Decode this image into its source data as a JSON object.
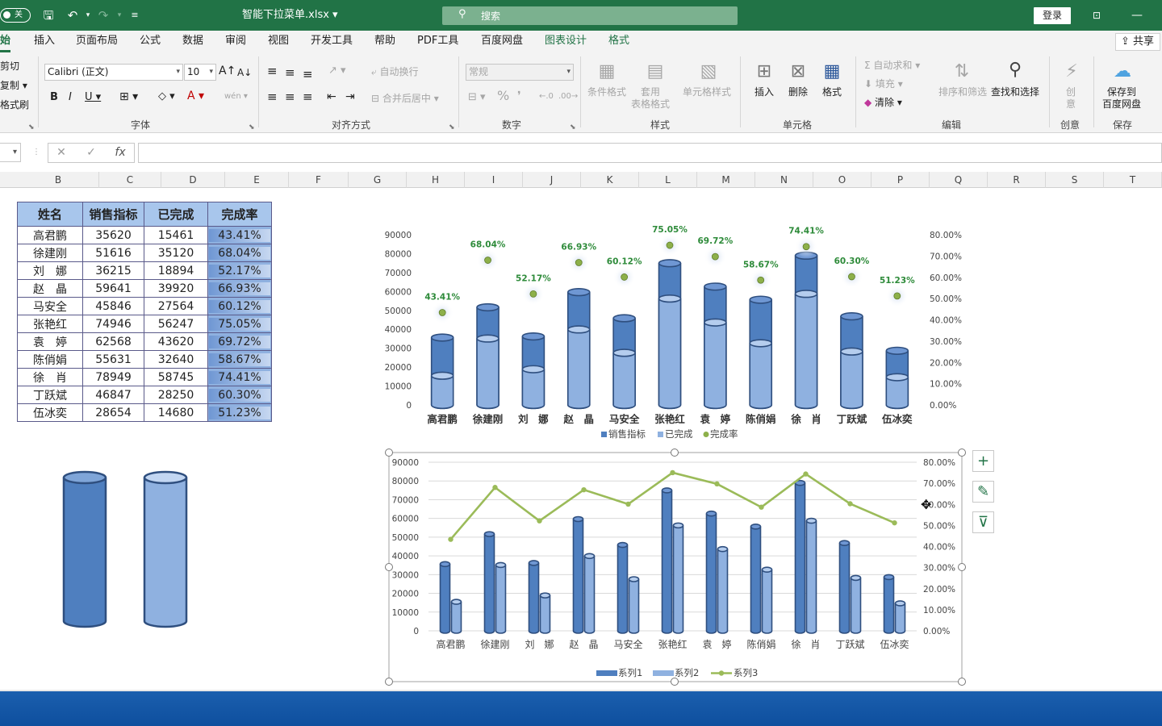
{
  "titlebar": {
    "autosave_label": "关",
    "doc_title": "智能下拉菜单.xlsx ▾",
    "search_placeholder": "搜索",
    "login_label": "登录"
  },
  "tabs": [
    "始",
    "插入",
    "页面布局",
    "公式",
    "数据",
    "审阅",
    "视图",
    "开发工具",
    "帮助",
    "PDF工具",
    "百度网盘",
    "图表设计",
    "格式"
  ],
  "share_label": "共享",
  "ribbon": {
    "clipboard": [
      "剪切",
      "复制 ▾",
      "格式刷"
    ],
    "font_name": "Calibri (正文)",
    "font_size": "10",
    "font_group": "字体",
    "wrap_text": "自动换行",
    "merge_center": "合并后居中 ▾",
    "align_group": "对齐方式",
    "number_format": "常规",
    "number_group": "数字",
    "styles": [
      "条件格式",
      "套用\n表格格式",
      "单元格样式"
    ],
    "styles_group": "样式",
    "cells": [
      "插入",
      "删除",
      "格式"
    ],
    "cells_group": "单元格",
    "autosum": "自动求和 ▾",
    "fill": "填充 ▾",
    "clear": "清除 ▾",
    "sort_filter": "排序和筛选",
    "find_select": "查找和选择",
    "edit_group": "编辑",
    "create_label": "创\n意",
    "create_group": "创意",
    "save_baidu": "保存到\n百度网盘",
    "save_group": "保存"
  },
  "columns": [
    "B",
    "C",
    "D",
    "E",
    "F",
    "G",
    "H",
    "I",
    "J",
    "K",
    "L",
    "M",
    "N",
    "O",
    "P",
    "Q",
    "R",
    "S",
    "T"
  ],
  "table": {
    "headers": [
      "姓名",
      "销售指标",
      "已完成",
      "完成率"
    ],
    "rows": [
      [
        "高君鹏",
        "35620",
        "15461",
        "43.41%"
      ],
      [
        "徐建刚",
        "51616",
        "35120",
        "68.04%"
      ],
      [
        "刘　娜",
        "36215",
        "18894",
        "52.17%"
      ],
      [
        "赵　晶",
        "59641",
        "39920",
        "66.93%"
      ],
      [
        "马安全",
        "45846",
        "27564",
        "60.12%"
      ],
      [
        "张艳红",
        "74946",
        "56247",
        "75.05%"
      ],
      [
        "袁　婷",
        "62568",
        "43620",
        "69.72%"
      ],
      [
        "陈俏娟",
        "55631",
        "32640",
        "58.67%"
      ],
      [
        "徐　肖",
        "78949",
        "58745",
        "74.41%"
      ],
      [
        "丁跃斌",
        "46847",
        "28250",
        "60.30%"
      ],
      [
        "伍冰奕",
        "28654",
        "14680",
        "51.23%"
      ]
    ]
  },
  "chart_data": [
    {
      "type": "bar",
      "categories": [
        "高君鹏",
        "徐建刚",
        "刘　娜",
        "赵　晶",
        "马安全",
        "张艳红",
        "袁　婷",
        "陈俏娟",
        "徐　肖",
        "丁跃斌",
        "伍冰奕"
      ],
      "series": [
        {
          "name": "销售指标",
          "values": [
            35620,
            51616,
            36215,
            59641,
            45846,
            74946,
            62568,
            55631,
            78949,
            46847,
            28654
          ]
        },
        {
          "name": "已完成",
          "values": [
            15461,
            35120,
            18894,
            39920,
            27564,
            56247,
            43620,
            32640,
            58745,
            28250,
            14680
          ]
        },
        {
          "name": "完成率",
          "values": [
            43.41,
            68.04,
            52.17,
            66.93,
            60.12,
            75.05,
            69.72,
            58.67,
            74.41,
            60.3,
            51.23
          ]
        }
      ],
      "rate_labels": [
        "43.41%",
        "68.04%",
        "52.17%",
        "66.93%",
        "60.12%",
        "75.05%",
        "69.72%",
        "58.67%",
        "74.41%",
        "60.30%",
        "51.23%"
      ],
      "ylim": [
        0,
        90000
      ],
      "yticks": [
        "90000",
        "80000",
        "70000",
        "60000",
        "50000",
        "40000",
        "30000",
        "20000",
        "10000",
        "0"
      ],
      "y2lim": [
        0,
        80
      ],
      "y2ticks": [
        "80.00%",
        "70.00%",
        "60.00%",
        "50.00%",
        "40.00%",
        "30.00%",
        "20.00%",
        "10.00%",
        "0.00%"
      ],
      "legend": "bottom",
      "grid": false
    },
    {
      "type": "bar",
      "categories": [
        "高君鹏",
        "徐建刚",
        "刘　娜",
        "赵　晶",
        "马安全",
        "张艳红",
        "袁　婷",
        "陈俏娟",
        "徐　肖",
        "丁跃斌",
        "伍冰奕"
      ],
      "series": [
        {
          "name": "系列1",
          "values": [
            35620,
            51616,
            36215,
            59641,
            45846,
            74946,
            62568,
            55631,
            78949,
            46847,
            28654
          ]
        },
        {
          "name": "系列2",
          "values": [
            15461,
            35120,
            18894,
            39920,
            27564,
            56247,
            43620,
            32640,
            58745,
            28250,
            14680
          ]
        },
        {
          "name": "系列3",
          "values": [
            43.41,
            68.04,
            52.17,
            66.93,
            60.12,
            75.05,
            69.72,
            58.67,
            74.41,
            60.3,
            51.23
          ]
        }
      ],
      "ylim": [
        0,
        90000
      ],
      "yticks": [
        "90000",
        "80000",
        "70000",
        "60000",
        "50000",
        "40000",
        "30000",
        "20000",
        "10000",
        "0"
      ],
      "y2lim": [
        0,
        80
      ],
      "y2ticks": [
        "80.00%",
        "70.00%",
        "60.00%",
        "50.00%",
        "40.00%",
        "30.00%",
        "20.00%",
        "10.00%",
        "0.00%"
      ],
      "legend": "bottom",
      "grid": true
    }
  ],
  "colors": {
    "excel_green": "#217346",
    "series_dark": "#4f7fbf",
    "series_light": "#8fb1e0",
    "rate_line": "#9bbb59",
    "rate_label": "#2e8b3a"
  }
}
